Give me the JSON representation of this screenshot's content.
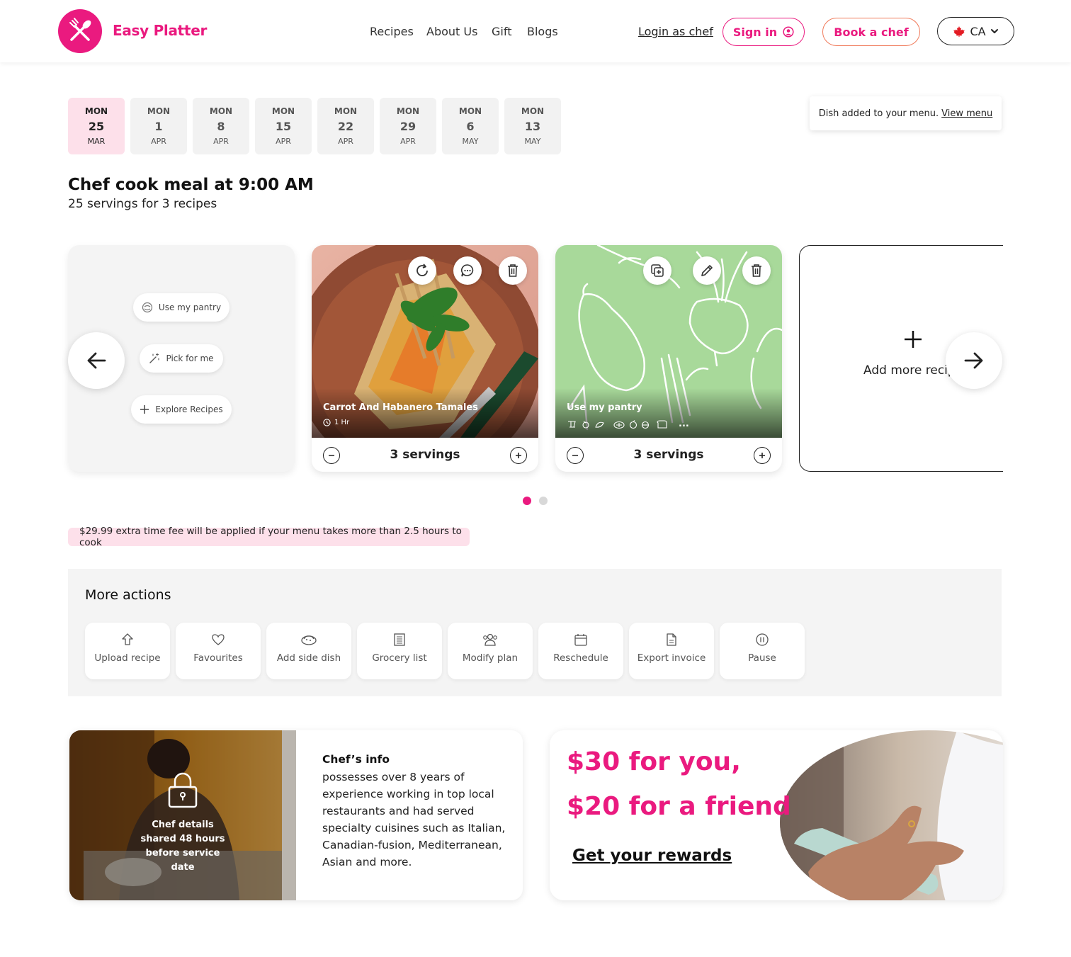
{
  "brand": {
    "name": "Easy Platter",
    "color": "#ea1a7f"
  },
  "nav": {
    "links": [
      "Recipes",
      "About Us",
      "Gift",
      "Blogs"
    ],
    "login_chef": "Login as chef",
    "sign_in": "Sign in",
    "book_chef": "Book a chef",
    "country": "CA"
  },
  "dates": [
    {
      "dow": "MON",
      "day": "25",
      "month": "MAR",
      "active": true
    },
    {
      "dow": "MON",
      "day": "1",
      "month": "APR"
    },
    {
      "dow": "MON",
      "day": "8",
      "month": "APR"
    },
    {
      "dow": "MON",
      "day": "15",
      "month": "APR"
    },
    {
      "dow": "MON",
      "day": "22",
      "month": "APR"
    },
    {
      "dow": "MON",
      "day": "29",
      "month": "APR"
    },
    {
      "dow": "MON",
      "day": "6",
      "month": "MAY"
    },
    {
      "dow": "MON",
      "day": "13",
      "month": "MAY"
    }
  ],
  "toast": {
    "text": "Dish added to your menu.",
    "link": "View menu"
  },
  "meal": {
    "title": "Chef cook meal at 9:00 AM",
    "subtitle": "25 servings for 3 recipes"
  },
  "quick_actions": {
    "pantry": "Use my pantry",
    "pick": "Pick for me",
    "explore": "Explore Recipes"
  },
  "recipes": [
    {
      "title": "Carrot And Habanero Tamales",
      "time": "1 Hr",
      "servings": "3 servings"
    },
    {
      "title": "Use my pantry",
      "more": "...",
      "servings": "3 servings"
    }
  ],
  "add_more": "Add more recipe",
  "carousel": {
    "pages": 2,
    "current": 1
  },
  "fee_notice": "$29.99 extra time fee will be applied if your menu takes more than 2.5 hours to cook",
  "more_actions": {
    "title": "More actions",
    "items": [
      {
        "label": "Upload recipe",
        "icon": "upload-icon"
      },
      {
        "label": "Favourites",
        "icon": "heart-icon"
      },
      {
        "label": "Add side dish",
        "icon": "dish-icon"
      },
      {
        "label": "Grocery list",
        "icon": "list-icon"
      },
      {
        "label": "Modify plan",
        "icon": "users-icon"
      },
      {
        "label": "Reschedule",
        "icon": "calendar-icon"
      },
      {
        "label": "Export invoice",
        "icon": "document-icon"
      },
      {
        "label": "Pause",
        "icon": "pause-icon"
      }
    ]
  },
  "chef": {
    "locked_text": "Chef details shared 48 hours before service date",
    "info_title": "Chef’s info",
    "info_body": "possesses over 8 years of experience working in top local restaurants and had served specialty cuisines such as Italian, Canadian-fusion, Mediterranean, Asian and more."
  },
  "rewards": {
    "line1": "$30 for you,",
    "line2": "$20 for a friend",
    "cta": "Get your rewards"
  }
}
